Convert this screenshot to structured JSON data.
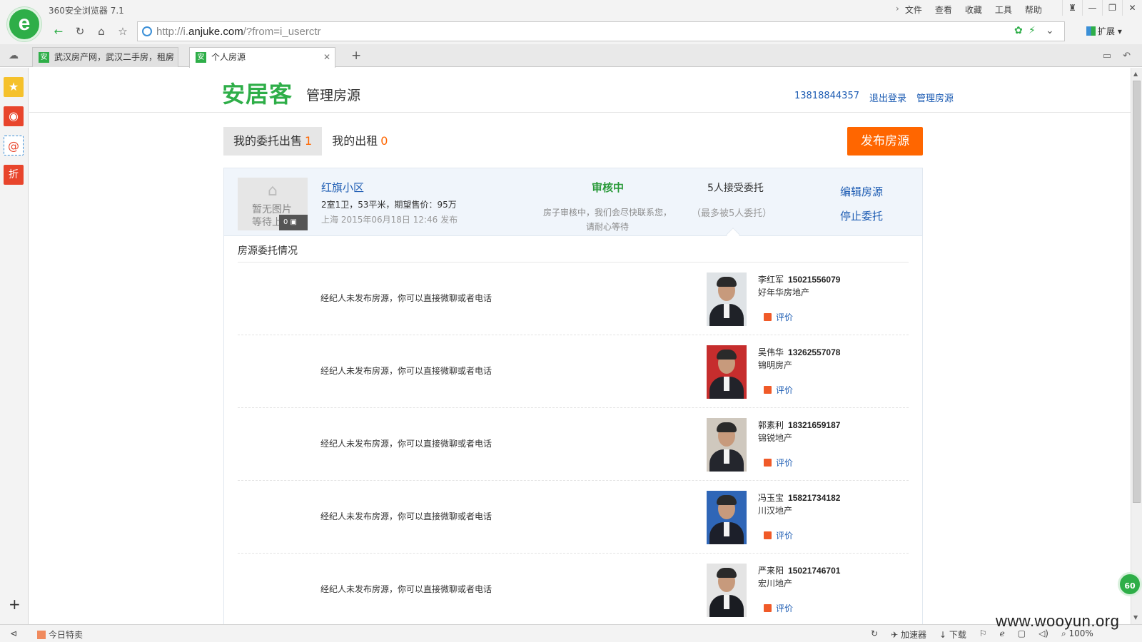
{
  "browser": {
    "app_title": "360安全浏览器 7.1",
    "menu": [
      "文件",
      "查看",
      "收藏",
      "工具",
      "帮助"
    ],
    "url_prefix": "http://i.",
    "url_domain": "anjuke.com",
    "url_suffix": "/?from=i_userctr",
    "extensions_label": "扩展",
    "tabs": [
      {
        "title": "武汉房产网，武汉二手房，租房",
        "favicon": "安",
        "active": false
      },
      {
        "title": "个人房源",
        "favicon": "安",
        "active": true
      }
    ],
    "sidebar_icons": [
      "star-icon",
      "weibo-icon",
      "mail-icon",
      "discount-icon"
    ],
    "sidebar_discount_label": "折",
    "statusbar": {
      "deal_label": "今日特卖",
      "accelerator_label": "加速器",
      "download_label": "下载",
      "zoom": "100%"
    },
    "badge": "60",
    "watermark": "www.wooyun.org"
  },
  "site": {
    "brand": "安居客",
    "section_title": "管理房源",
    "user_phone": "13818844357",
    "logout_label": "退出登录",
    "manage_label": "管理房源"
  },
  "tabs": [
    {
      "label": "我的委托出售",
      "count": "1",
      "selected": true
    },
    {
      "label": "我的出租",
      "count": "0",
      "selected": false
    }
  ],
  "publish_label": "发布房源",
  "listing": {
    "no_image_line1": "暂无图片",
    "no_image_line2": "等待上",
    "image_count": "0",
    "name": "红旗小区",
    "info": "2室1卫，53平米，期望售价：95万",
    "date": "上海  2015年06月18日  12:46  发布",
    "status": "审核中",
    "status_note_1": "房子审核中，我们会尽快联系您，",
    "status_note_2": "请耐心等待",
    "accepted": "5人接受委托",
    "accepted_note": "（最多被5人委托）",
    "edit_label": "编辑房源",
    "stop_label": "停止委托"
  },
  "panel_title": "房源委托情况",
  "agents": [
    {
      "message": "经纪人未发布房源，你可以直接微聊或者电话",
      "name": "李红军",
      "phone": "15021556079",
      "company": "好年华房地产",
      "rate_label": "评价",
      "bg": "#dfe3e6",
      "suit": "#1f2228"
    },
    {
      "message": "经纪人未发布房源，你可以直接微聊或者电话",
      "name": "吴伟华",
      "phone": "13262557078",
      "company": "锦明房产",
      "rate_label": "评价",
      "bg": "#c62d2d",
      "suit": "#22232a"
    },
    {
      "message": "经纪人未发布房源，你可以直接微聊或者电话",
      "name": "郭素利",
      "phone": "18321659187",
      "company": "锦锐地产",
      "rate_label": "评价",
      "bg": "#cfc8be",
      "suit": "#24262d"
    },
    {
      "message": "经纪人未发布房源，你可以直接微聊或者电话",
      "name": "冯玉宝",
      "phone": "15821734182",
      "company": "川汉地产",
      "rate_label": "评价",
      "bg": "#2f66b7",
      "suit": "#1c1f2a"
    },
    {
      "message": "经纪人未发布房源，你可以直接微聊或者电话",
      "name": "严来阳",
      "phone": "15021746701",
      "company": "宏川地产",
      "rate_label": "评价",
      "bg": "#e4e4e4",
      "suit": "#1a1c22"
    }
  ]
}
